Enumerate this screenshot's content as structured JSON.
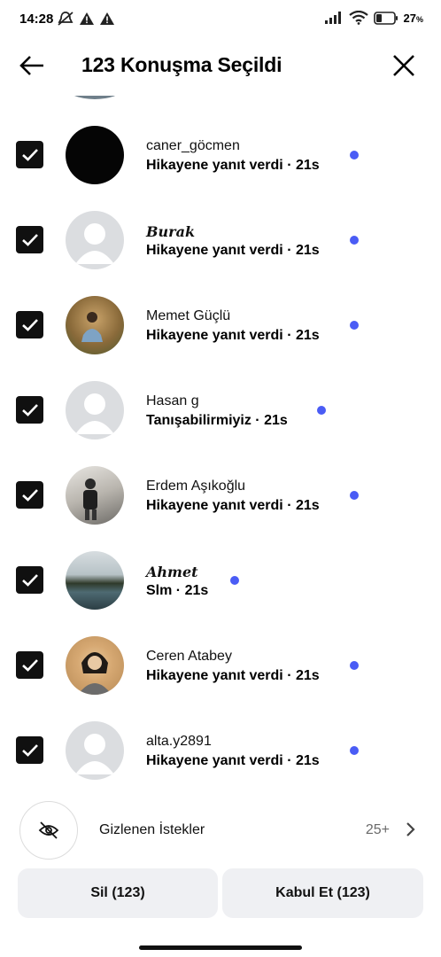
{
  "status": {
    "time": "14:28",
    "battery": "27"
  },
  "header": {
    "title": "123 Konuşma Seçildi"
  },
  "conversations": [
    {
      "name": "caner_göcmen",
      "preview": "Hikayene yanıt verdi · 21s",
      "avatar": "black"
    },
    {
      "name": "Burak",
      "preview": "Hikayene yanıt verdi · 21s",
      "avatar": "default"
    },
    {
      "name": "Memet Güçlü",
      "preview": "Hikayene yanıt verdi · 21s",
      "avatar": "photo-warm"
    },
    {
      "name": "Hasan g",
      "preview": "Tanışabilirmiyiz · 21s",
      "avatar": "default"
    },
    {
      "name": "Erdem Aşıkoğlu",
      "preview": "Hikayene yanıt verdi · 21s",
      "avatar": "photo-indoor"
    },
    {
      "name": "Ahmet",
      "preview": "Slm · 21s",
      "avatar": "photo-lake"
    },
    {
      "name": "Ceren Atabey",
      "preview": "Hikayene yanıt verdi · 21s",
      "avatar": "photo-portrait"
    },
    {
      "name": "alta.y2891",
      "preview": "Hikayene yanıt verdi · 21s",
      "avatar": "default"
    }
  ],
  "hidden_requests": {
    "label": "Gizlenen İstekler",
    "count": "25+"
  },
  "actions": {
    "delete_label": "Sil (123)",
    "accept_label": "Kabul Et (123)"
  },
  "colors": {
    "unread_dot": "#4a5cf5",
    "button_bg": "#eff0f3"
  },
  "icons": {
    "back": "arrow-left-icon",
    "close": "close-icon",
    "hidden": "eye-slash-icon",
    "chevron": "chevron-right-icon"
  }
}
